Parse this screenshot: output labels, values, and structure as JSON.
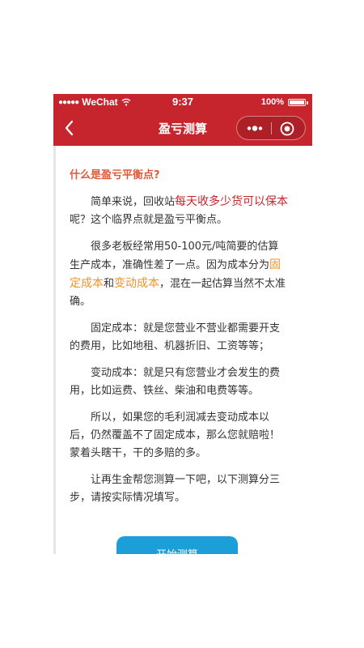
{
  "status_bar": {
    "signal": "●●●●●",
    "carrier": "WeChat",
    "time": "9:37",
    "battery_percent": "100%"
  },
  "nav": {
    "title": "盈亏测算",
    "back_icon": "chevron-left-icon",
    "more_icon": "more-dots-icon",
    "close_icon": "record-close-icon"
  },
  "content": {
    "title": "什么是盈亏平衡点?",
    "p1": {
      "a": "简单来说，回收站",
      "highlight": "每天收多少货可以保本",
      "b": "呢？这个临界点就是盈亏平衡点。"
    },
    "p2": {
      "a": "很多老板经常用50-100元/吨简要的估算生产成本，准确性差了一点。因为成本分为",
      "fixed": "固定成本",
      "and": "和",
      "variable": "变动成本",
      "b": "，混在一起估算当然不太准确。"
    },
    "p3": "固定成本：就是您营业不营业都需要开支的费用，比如地租、机器折旧、工资等等；",
    "p4": "变动成本：就是只有您营业才会发生的费用，比如运费、铁丝、柴油和电费等等。",
    "p5": "所以，如果您的毛利润减去变动成本以后，仍然覆盖不了固定成本，那么您就赔啦！蒙着头瞎干，干的多赔的多。",
    "p6": "让再生金帮您测算一下吧，以下测算分三步，请按实际情况填写。"
  },
  "start_button": {
    "label": "开始测算"
  },
  "colors": {
    "brand_red": "#c7252d",
    "title_orange": "#e0593a",
    "highlight_orange": "#f0932b",
    "button_blue": "#1c9fd8"
  }
}
